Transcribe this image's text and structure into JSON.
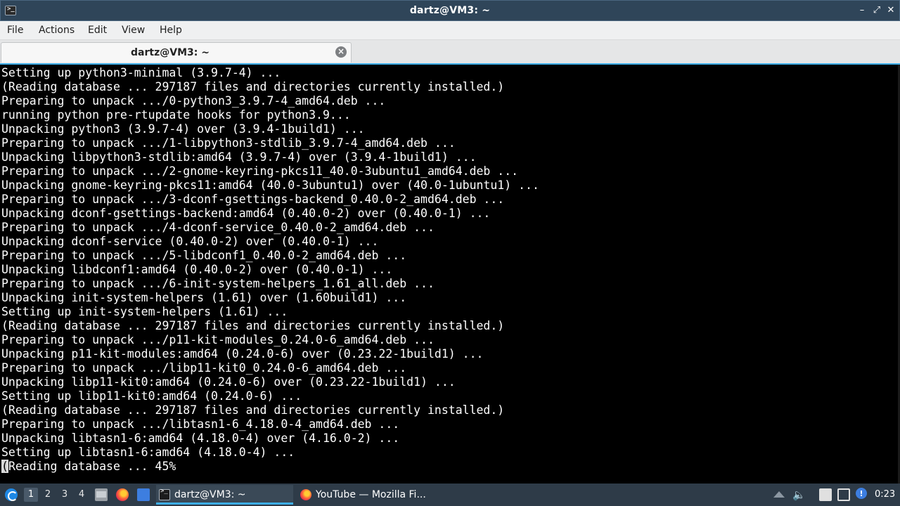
{
  "window": {
    "title": "dartz@VM3: ~",
    "minimize_icon": "minimize-icon",
    "restore_icon": "restore-icon",
    "close_icon": "close-icon"
  },
  "menubar": {
    "items": [
      "File",
      "Actions",
      "Edit",
      "View",
      "Help"
    ]
  },
  "tabs": [
    {
      "label": "dartz@VM3: ~",
      "close_icon": "close-tab-icon"
    }
  ],
  "terminal": {
    "lines": [
      "Setting up python3-minimal (3.9.7-4) ...",
      "(Reading database ... 297187 files and directories currently installed.)",
      "Preparing to unpack .../0-python3_3.9.7-4_amd64.deb ...",
      "running python pre-rtupdate hooks for python3.9...",
      "Unpacking python3 (3.9.7-4) over (3.9.4-1build1) ...",
      "Preparing to unpack .../1-libpython3-stdlib_3.9.7-4_amd64.deb ...",
      "Unpacking libpython3-stdlib:amd64 (3.9.7-4) over (3.9.4-1build1) ...",
      "Preparing to unpack .../2-gnome-keyring-pkcs11_40.0-3ubuntu1_amd64.deb ...",
      "Unpacking gnome-keyring-pkcs11:amd64 (40.0-3ubuntu1) over (40.0-1ubuntu1) ...",
      "Preparing to unpack .../3-dconf-gsettings-backend_0.40.0-2_amd64.deb ...",
      "Unpacking dconf-gsettings-backend:amd64 (0.40.0-2) over (0.40.0-1) ...",
      "Preparing to unpack .../4-dconf-service_0.40.0-2_amd64.deb ...",
      "Unpacking dconf-service (0.40.0-2) over (0.40.0-1) ...",
      "Preparing to unpack .../5-libdconf1_0.40.0-2_amd64.deb ...",
      "Unpacking libdconf1:amd64 (0.40.0-2) over (0.40.0-1) ...",
      "Preparing to unpack .../6-init-system-helpers_1.61_all.deb ...",
      "Unpacking init-system-helpers (1.61) over (1.60build1) ...",
      "Setting up init-system-helpers (1.61) ...",
      "(Reading database ... 297187 files and directories currently installed.)",
      "Preparing to unpack .../p11-kit-modules_0.24.0-6_amd64.deb ...",
      "Unpacking p11-kit-modules:amd64 (0.24.0-6) over (0.23.22-1build1) ...",
      "Preparing to unpack .../libp11-kit0_0.24.0-6_amd64.deb ...",
      "Unpacking libp11-kit0:amd64 (0.24.0-6) over (0.23.22-1build1) ...",
      "Setting up libp11-kit0:amd64 (0.24.0-6) ...",
      "(Reading database ... 297187 files and directories currently installed.)",
      "Preparing to unpack .../libtasn1-6_4.18.0-4_amd64.deb ...",
      "Unpacking libtasn1-6:amd64 (4.18.0-4) over (4.16.0-2) ...",
      "Setting up libtasn1-6:amd64 (4.18.0-4) ..."
    ],
    "current_line_cursor_char": "(",
    "current_line_rest": "Reading database ... 45%"
  },
  "taskbar": {
    "start_icon": "app-launcher-icon",
    "desktops": [
      "1",
      "2",
      "3",
      "4"
    ],
    "active_desktop": "1",
    "quicklaunch": [
      "file-manager-icon",
      "firefox-icon",
      "show-desktop-icon"
    ],
    "tasks": [
      {
        "label": "dartz@VM3: ~",
        "icon": "terminal-icon",
        "active": true
      },
      {
        "label": "YouTube — Mozilla Fi...",
        "icon": "firefox-icon",
        "active": false
      }
    ],
    "tray": [
      "tray-expand-icon",
      "volume-icon",
      "clipboard-icon",
      "network-icon",
      "notification-icon"
    ],
    "clock": "0:23"
  },
  "colors": {
    "titlebar": "#2f4559",
    "terminal_bg": "#000000",
    "terminal_fg": "#ffffff",
    "accent": "#3daee9",
    "taskbar": "#2e3b48"
  }
}
